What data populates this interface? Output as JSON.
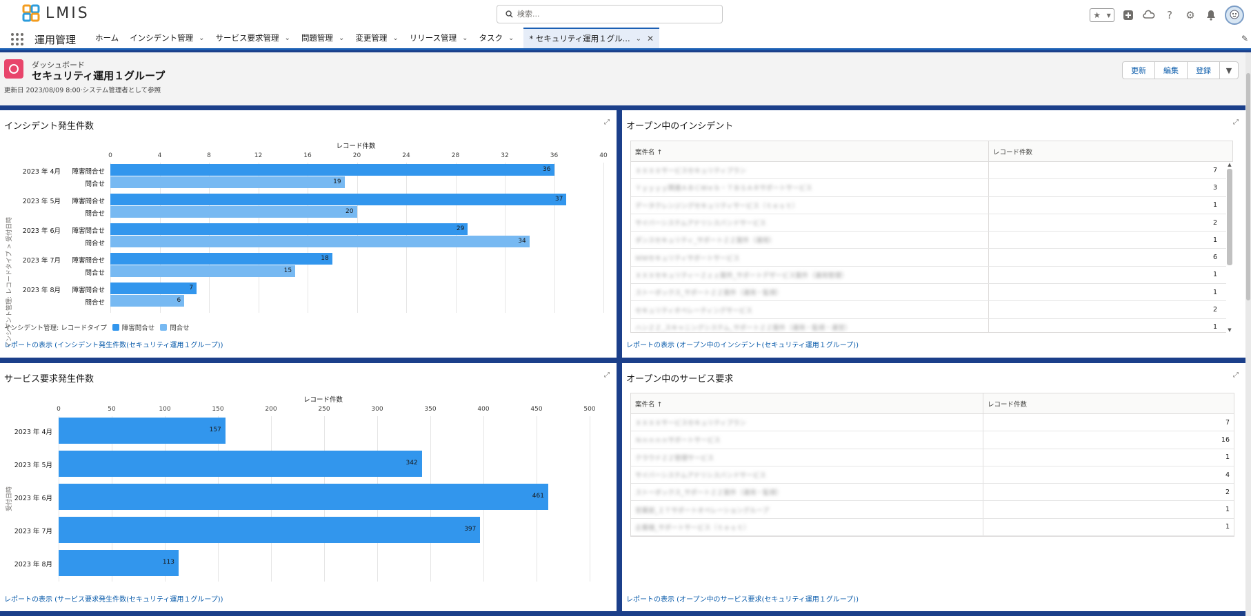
{
  "header": {
    "logo_text": "LMIS",
    "search_placeholder": "検索...",
    "icons": [
      "star-icon",
      "plus-icon",
      "cloud-icon",
      "help-icon",
      "gear-icon",
      "bell-icon",
      "avatar"
    ]
  },
  "nav": {
    "app_name": "運用管理",
    "items": [
      {
        "label": "ホーム",
        "dropdown": false
      },
      {
        "label": "インシデント管理",
        "dropdown": true
      },
      {
        "label": "サービス要求管理",
        "dropdown": true
      },
      {
        "label": "問題管理",
        "dropdown": true
      },
      {
        "label": "変更管理",
        "dropdown": true
      },
      {
        "label": "リリース管理",
        "dropdown": true
      },
      {
        "label": "タスク",
        "dropdown": true
      }
    ],
    "active_tab": "* セキュリティ運用１グル..."
  },
  "dashboard": {
    "subtitle": "ダッシュボード",
    "title": "セキュリティ運用１グループ",
    "meta": "更新日 2023/08/09 8:00·システム管理者として参照",
    "buttons": {
      "refresh": "更新",
      "edit": "編集",
      "subscribe": "登録"
    }
  },
  "panels": {
    "incidents_chart": {
      "title": "インシデント発生件数",
      "link": "レポートの表示 (インシデント発生件数(セキュリティ運用１グループ))",
      "legend_title": "インシデント管理: レコードタイプ",
      "y_axis_title": "インシデント管理: レコードタイプ > 受付日時"
    },
    "open_incidents": {
      "title": "オープン中のインシデント",
      "col1": "案件名 ↑",
      "col2": "レコード件数",
      "link": "レポートの表示 (オープン中のインシデント(セキュリティ運用１グループ))",
      "rows": [
        {
          "name": "ＸＸＸＸサービスセキュリティプラン",
          "count": "7"
        },
        {
          "name": "Ｙｙｙｙｙ関連ＡＢＣＷｅｂ・ＴＢＳＡＲサポートサービス",
          "count": "3"
        },
        {
          "name": "データクレンジングセキュリティサービス（ｔｅｓｔ）",
          "count": "1"
        },
        {
          "name": "サイバーシステムアナリシスバンドサービス",
          "count": "2"
        },
        {
          "name": "ダンスセキュリティ_サポートＺＺ案件（運用）",
          "count": "1"
        },
        {
          "name": "ＭＭセキュリティサポートサービス",
          "count": "6"
        },
        {
          "name": "ＸＸＸセキュリティーＺｚｚ案件_サポートデザービス案件（運用管理）",
          "count": "1"
        },
        {
          "name": "ストーボックス_サポートＺＺ案件（運用・監視）",
          "count": "1"
        },
        {
          "name": "セキュリティオペレーティングサービス",
          "count": "2"
        },
        {
          "name": "ハンＺＺ_スキャニングシステム_サポートＺＺ案件（運用・監視・運営）",
          "count": "1"
        }
      ]
    },
    "service_chart": {
      "title": "サービス要求発生件数",
      "link": "レポートの表示 (サービス要求発生件数(セキュリティ運用１グループ))",
      "y_axis_title": "受付日時"
    },
    "open_service": {
      "title": "オープン中のサービス要求",
      "col1": "案件名 ↑",
      "col2": "レコード件数",
      "link": "レポートの表示 (オープン中のサービス要求(セキュリティ運用１グループ))",
      "rows": [
        {
          "name": "ＸＸＸＸサービスセキュリティプラン",
          "count": "7"
        },
        {
          "name": "Ｎｎｎｎｎサポートサービス",
          "count": "16"
        },
        {
          "name": "クラウドＺＺ管理サービス",
          "count": "1"
        },
        {
          "name": "サイバーシステムアナリシスバンドサービス",
          "count": "4"
        },
        {
          "name": "ストーボックス_サポートＺＺ案件（運用・監視）",
          "count": "2"
        },
        {
          "name": "営業部_ＩＴサポートオペレーショングループ",
          "count": "1"
        },
        {
          "name": "企業様_サポートサービス（ｔｅｓｔ）",
          "count": "1"
        }
      ]
    }
  },
  "chart_data": [
    {
      "type": "bar",
      "orientation": "horizontal",
      "title": "インシデント発生件数",
      "xlabel": "レコード件数",
      "xlim": [
        0,
        40
      ],
      "xticks": [
        0,
        4,
        8,
        12,
        16,
        20,
        24,
        28,
        32,
        36,
        40
      ],
      "groups": [
        "2023 年 4月",
        "2023 年 5月",
        "2023 年 6月",
        "2023 年 7月",
        "2023 年 8月"
      ],
      "series": [
        {
          "name": "障害問合せ",
          "color": "#3296ed",
          "values": [
            36,
            37,
            29,
            18,
            7
          ]
        },
        {
          "name": "問合せ",
          "color": "#77b9f2",
          "values": [
            19,
            20,
            34,
            15,
            6
          ]
        }
      ]
    },
    {
      "type": "bar",
      "orientation": "horizontal",
      "title": "サービス要求発生件数",
      "xlabel": "レコード件数",
      "ylabel": "受付日時",
      "xlim": [
        0,
        500
      ],
      "xticks": [
        0,
        50,
        100,
        150,
        200,
        250,
        300,
        350,
        400,
        450,
        500
      ],
      "categories": [
        "2023 年 4月",
        "2023 年 5月",
        "2023 年 6月",
        "2023 年 7月",
        "2023 年 8月"
      ],
      "values": [
        157,
        342,
        461,
        397,
        113
      ],
      "color": "#3296ed"
    }
  ]
}
